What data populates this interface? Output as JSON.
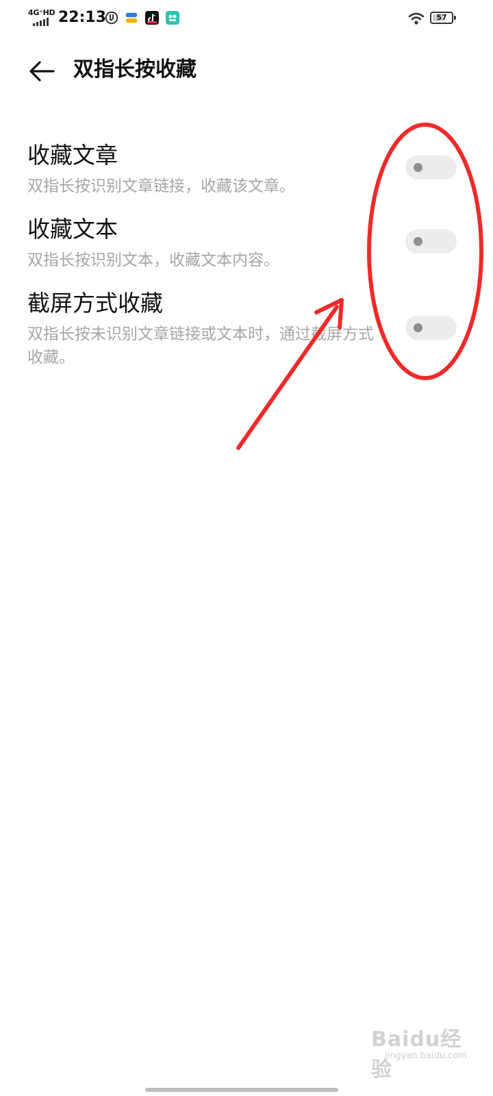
{
  "status_bar": {
    "network": "4G⁺HD",
    "time": "22:13",
    "battery": "57",
    "battery_level": 0.57,
    "icons": [
      "vpn-icon",
      "kids-app-icon",
      "tiktok-icon",
      "game-app-icon",
      "wifi-icon",
      "battery-icon"
    ]
  },
  "header": {
    "back_icon": "back-arrow-icon",
    "title": "双指长按收藏"
  },
  "settings": [
    {
      "title": "收藏文章",
      "description": "双指长按识别文章链接，收藏该文章。",
      "enabled": false
    },
    {
      "title": "收藏文本",
      "description": "双指长按识别文本，收藏文本内容。",
      "enabled": false
    },
    {
      "title": "截屏方式收藏",
      "description": "双指长按未识别文章链接或文本时，通过截屏方式收藏。",
      "enabled": false
    }
  ],
  "annotation": {
    "color": "#ee2a2a",
    "shapes": [
      "ellipse",
      "arrow"
    ]
  },
  "watermark": {
    "logo": "Baidu经验",
    "url": "jingyan.baidu.com"
  },
  "colors": {
    "toggle_track": "#ececec",
    "toggle_knob": "#8e8e8e",
    "secondary_text": "#a6a6a6"
  }
}
